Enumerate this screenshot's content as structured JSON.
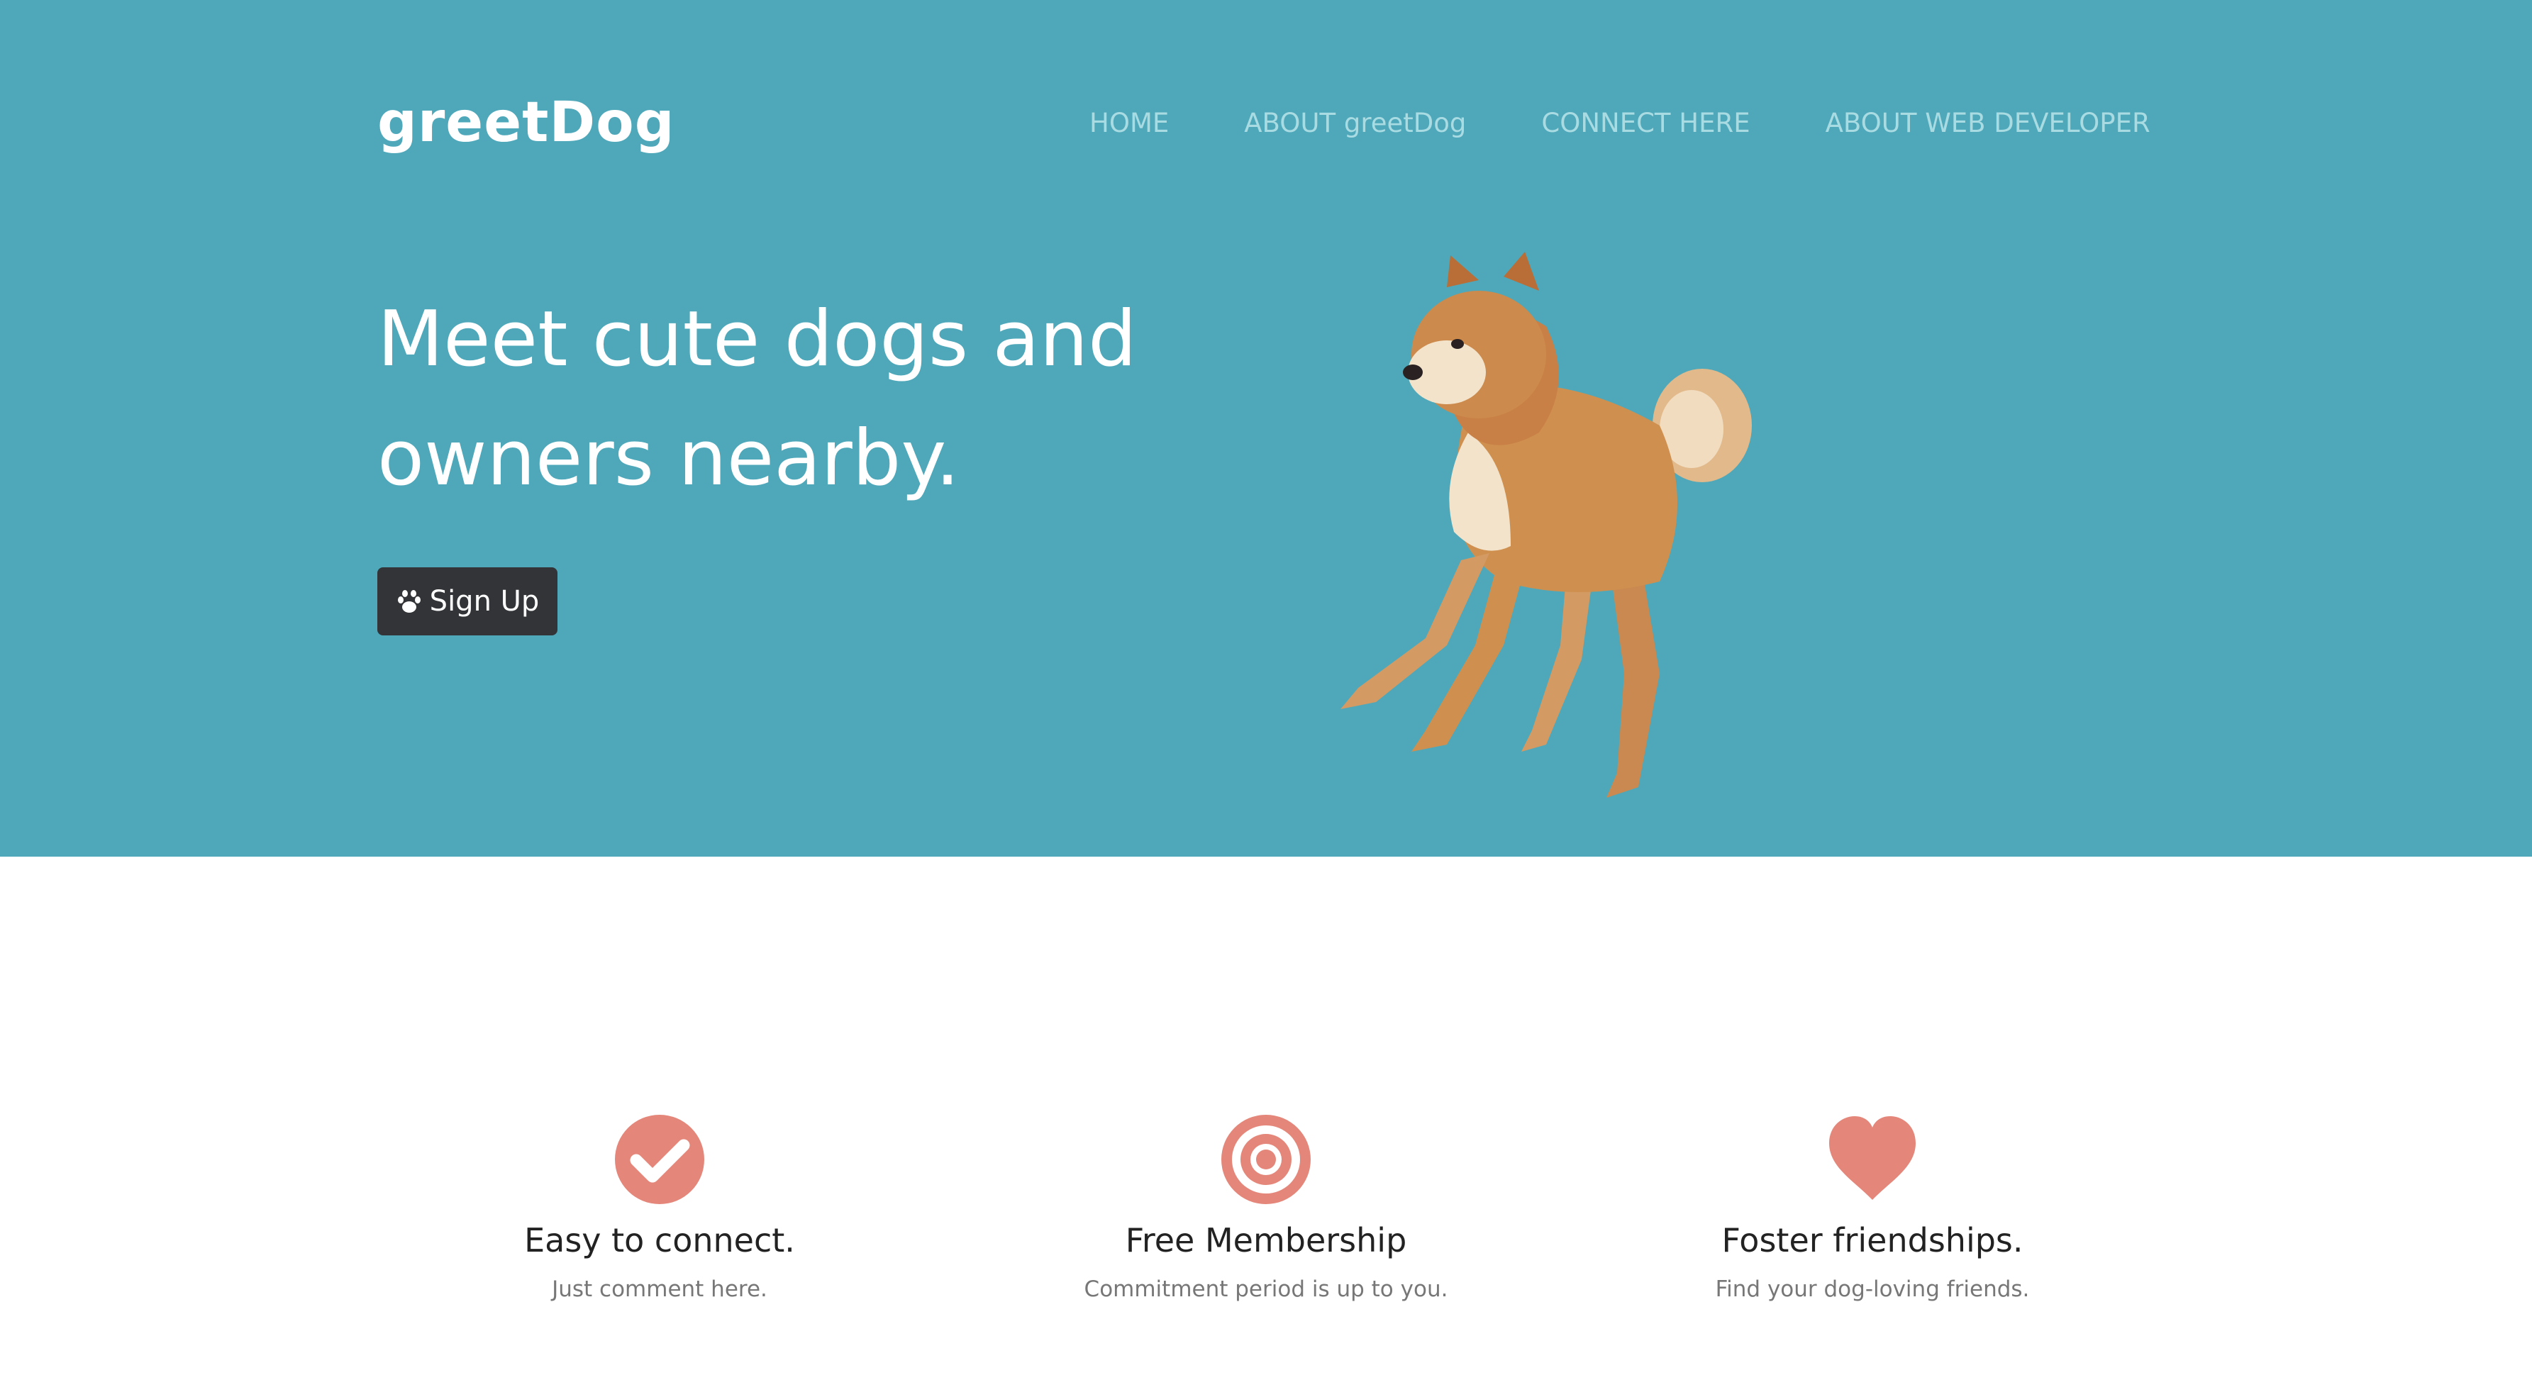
{
  "brand": "greetDog",
  "nav": {
    "items": [
      "HOME",
      "ABOUT greetDog",
      "CONNECT HERE",
      "ABOUT WEB DEVELOPER"
    ]
  },
  "hero": {
    "headline_line1": "Meet cute dogs and",
    "headline_line2": "owners nearby.",
    "signup_label": "Sign Up",
    "signup_icon": "paw-icon",
    "image": "shiba-inu-dog"
  },
  "features": [
    {
      "icon": "check-circle-icon",
      "title": "Easy to connect.",
      "subtitle": "Just comment here."
    },
    {
      "icon": "target-icon",
      "title": "Free Membership",
      "subtitle": "Commitment period is up to you."
    },
    {
      "icon": "heart-icon",
      "title": "Foster friendships.",
      "subtitle": "Find your dog-loving friends."
    }
  ],
  "colors": {
    "hero_bg": "#4ea8ba",
    "nav_text": "#a9dbe3",
    "button_bg": "#333438",
    "accent": "#e4877a"
  }
}
